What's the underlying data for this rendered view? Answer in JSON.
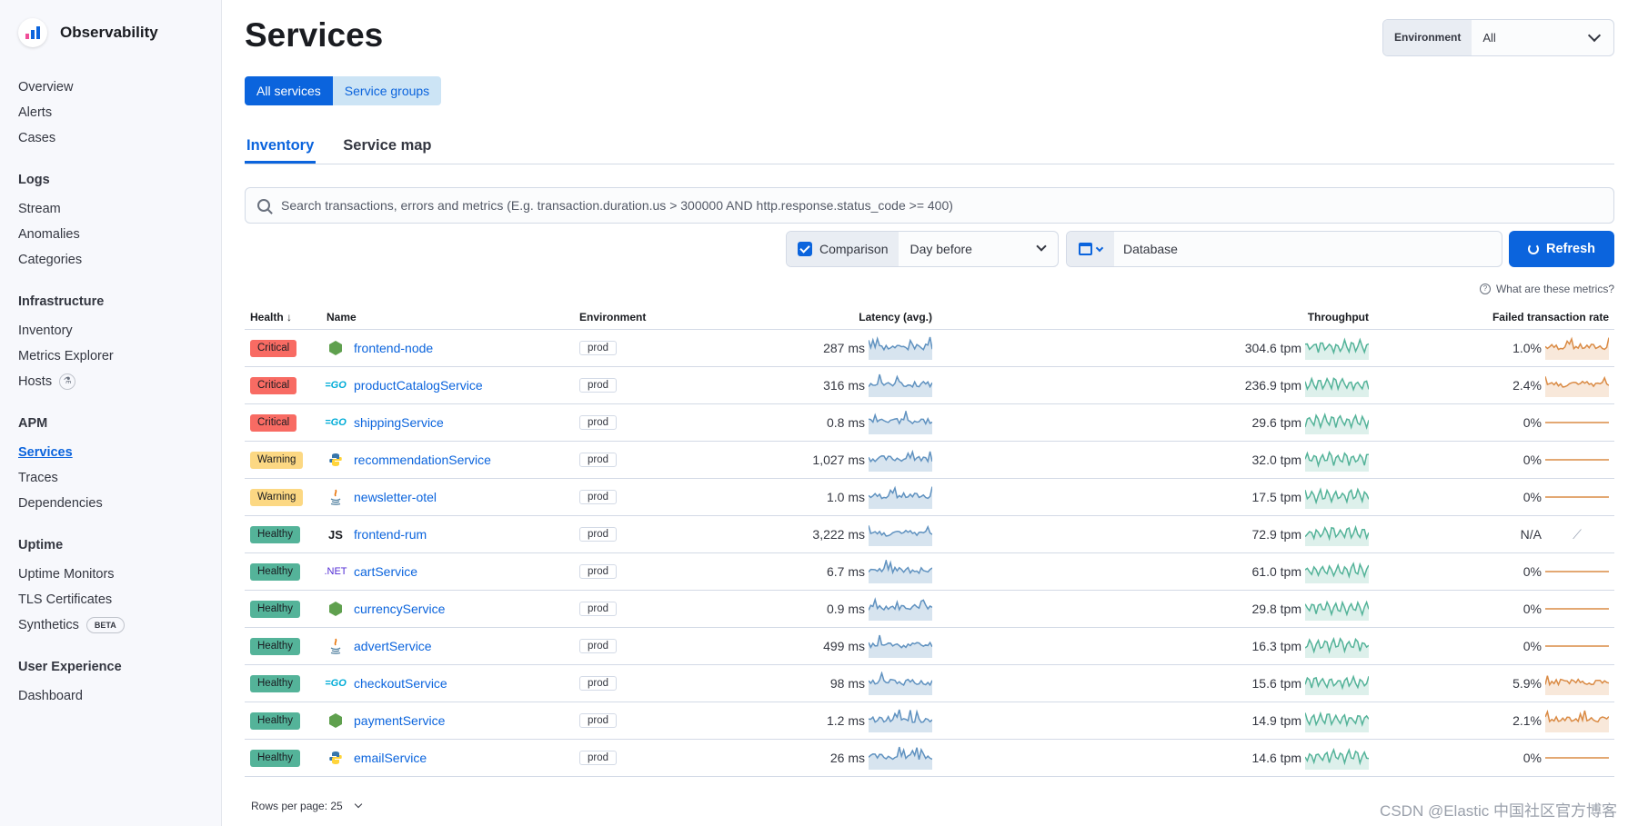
{
  "sidebar": {
    "brand": "Observability",
    "groups": [
      {
        "heading": "",
        "items": [
          {
            "label": "Overview"
          },
          {
            "label": "Alerts"
          },
          {
            "label": "Cases"
          }
        ]
      },
      {
        "heading": "Logs",
        "items": [
          {
            "label": "Stream"
          },
          {
            "label": "Anomalies"
          },
          {
            "label": "Categories"
          }
        ]
      },
      {
        "heading": "Infrastructure",
        "items": [
          {
            "label": "Inventory"
          },
          {
            "label": "Metrics Explorer"
          },
          {
            "label": "Hosts",
            "icon": "beaker-icon"
          }
        ]
      },
      {
        "heading": "APM",
        "items": [
          {
            "label": "Services",
            "active": true
          },
          {
            "label": "Traces"
          },
          {
            "label": "Dependencies"
          }
        ]
      },
      {
        "heading": "Uptime",
        "items": [
          {
            "label": "Uptime Monitors"
          },
          {
            "label": "TLS Certificates"
          },
          {
            "label": "Synthetics",
            "badge": "BETA"
          }
        ]
      },
      {
        "heading": "User Experience",
        "items": [
          {
            "label": "Dashboard"
          }
        ]
      }
    ]
  },
  "header": {
    "title": "Services",
    "env_label": "Environment",
    "env_value": "All"
  },
  "view_toggle": {
    "all": "All services",
    "groups": "Service groups"
  },
  "tabs": [
    {
      "label": "Inventory",
      "active": true
    },
    {
      "label": "Service map"
    }
  ],
  "search": {
    "placeholder": "Search transactions, errors and metrics (E.g. transaction.duration.us > 300000 AND http.response.status_code >= 400)"
  },
  "comparison": {
    "label": "Comparison",
    "value": "Day before"
  },
  "datepicker": {
    "value": "Database"
  },
  "refresh_label": "Refresh",
  "metrics_help": "What are these metrics?",
  "table": {
    "columns": {
      "health": "Health",
      "name": "Name",
      "environment": "Environment",
      "latency": "Latency (avg.)",
      "throughput": "Throughput",
      "failed": "Failed transaction rate"
    },
    "rows": [
      {
        "health": "Critical",
        "icon": "node",
        "name": "frontend-node",
        "env": "prod",
        "latency": "287 ms",
        "throughput": "304.6 tpm",
        "failed": "1.0%"
      },
      {
        "health": "Critical",
        "icon": "go",
        "name": "productCatalogService",
        "env": "prod",
        "latency": "316 ms",
        "throughput": "236.9 tpm",
        "failed": "2.4%"
      },
      {
        "health": "Critical",
        "icon": "go",
        "name": "shippingService",
        "env": "prod",
        "latency": "0.8 ms",
        "throughput": "29.6 tpm",
        "failed": "0%"
      },
      {
        "health": "Warning",
        "icon": "python",
        "name": "recommendationService",
        "env": "prod",
        "latency": "1,027 ms",
        "throughput": "32.0 tpm",
        "failed": "0%"
      },
      {
        "health": "Warning",
        "icon": "java",
        "name": "newsletter-otel",
        "env": "prod",
        "latency": "1.0 ms",
        "throughput": "17.5 tpm",
        "failed": "0%"
      },
      {
        "health": "Healthy",
        "icon": "js",
        "name": "frontend-rum",
        "env": "prod",
        "latency": "3,222 ms",
        "throughput": "72.9 tpm",
        "failed": "N/A"
      },
      {
        "health": "Healthy",
        "icon": "dotnet",
        "name": "cartService",
        "env": "prod",
        "latency": "6.7 ms",
        "throughput": "61.0 tpm",
        "failed": "0%"
      },
      {
        "health": "Healthy",
        "icon": "node",
        "name": "currencyService",
        "env": "prod",
        "latency": "0.9 ms",
        "throughput": "29.8 tpm",
        "failed": "0%"
      },
      {
        "health": "Healthy",
        "icon": "java",
        "name": "advertService",
        "env": "prod",
        "latency": "499 ms",
        "throughput": "16.3 tpm",
        "failed": "0%"
      },
      {
        "health": "Healthy",
        "icon": "go",
        "name": "checkoutService",
        "env": "prod",
        "latency": "98 ms",
        "throughput": "15.6 tpm",
        "failed": "5.9%"
      },
      {
        "health": "Healthy",
        "icon": "node",
        "name": "paymentService",
        "env": "prod",
        "latency": "1.2 ms",
        "throughput": "14.9 tpm",
        "failed": "2.1%"
      },
      {
        "health": "Healthy",
        "icon": "python",
        "name": "emailService",
        "env": "prod",
        "latency": "26 ms",
        "throughput": "14.6 tpm",
        "failed": "0%"
      }
    ]
  },
  "footer": {
    "rows_per_page": "Rows per page: 25"
  },
  "watermark": "CSDN @Elastic 中国社区官方博客",
  "colors": {
    "primary": "#0b64dd",
    "critical": "#f86b63",
    "warning": "#fcd883",
    "healthy": "#54b399",
    "latency_line": "#6092c0",
    "throughput_line": "#54b399",
    "failed_line": "#da8b45"
  }
}
